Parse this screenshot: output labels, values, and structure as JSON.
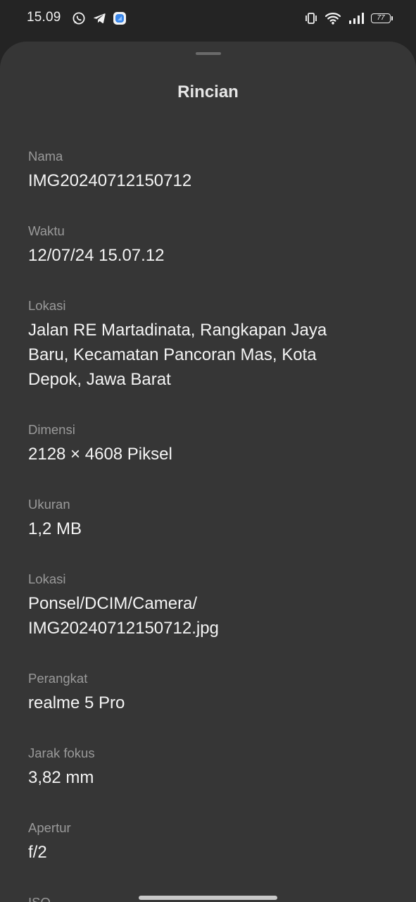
{
  "status_bar": {
    "time": "15.09",
    "left_icons": [
      "whatsapp-icon",
      "telegram-icon",
      "app-icon"
    ],
    "right_icons": [
      "vibrate-icon",
      "wifi-icon",
      "signal-icon"
    ],
    "battery": "77"
  },
  "sheet": {
    "title": "Rincian",
    "details": [
      {
        "label": "Nama",
        "value": "IMG20240712150712"
      },
      {
        "label": "Waktu",
        "value": "12/07/24 15.07.12"
      },
      {
        "label": "Lokasi",
        "value": "Jalan RE Martadinata, Rangkapan Jaya Baru, Kecamatan Pancoran Mas, Kota Depok, Jawa Barat"
      },
      {
        "label": "Dimensi",
        "value": "2128 × 4608 Piksel"
      },
      {
        "label": "Ukuran",
        "value": "1,2 MB"
      },
      {
        "label": "Lokasi",
        "value": "Ponsel/DCIM/Camera/\nIMG20240712150712.jpg"
      },
      {
        "label": "Perangkat",
        "value": "realme 5 Pro"
      },
      {
        "label": "Jarak fokus",
        "value": "3,82 mm"
      },
      {
        "label": "Apertur",
        "value": "f/2"
      },
      {
        "label": "ISO",
        "value": ""
      }
    ]
  }
}
